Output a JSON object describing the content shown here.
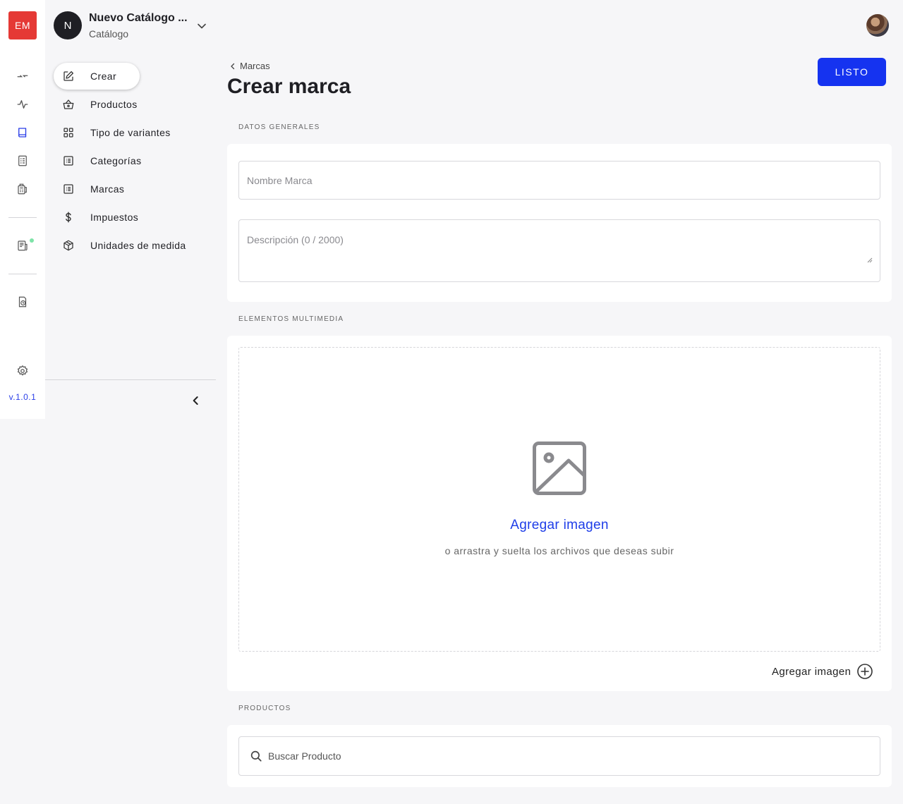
{
  "rail": {
    "logo": "EM",
    "version": "v.1.0.1",
    "icons": [
      "transfer-icon",
      "activity-icon",
      "book-icon",
      "checklist-icon",
      "pos-icon",
      "orders-icon",
      "reports-icon",
      "settings-icon"
    ]
  },
  "catalog": {
    "avatar_letter": "N",
    "title": "Nuevo Catálogo ...",
    "subtitle": "Catálogo"
  },
  "nav": {
    "items": [
      {
        "label": "Crear",
        "icon": "edit-icon"
      },
      {
        "label": "Productos",
        "icon": "basket-icon"
      },
      {
        "label": "Tipo de variantes",
        "icon": "grid-icon"
      },
      {
        "label": "Categorías",
        "icon": "list-icon"
      },
      {
        "label": "Marcas",
        "icon": "list-icon"
      },
      {
        "label": "Impuestos",
        "icon": "dollar-icon"
      },
      {
        "label": "Unidades de medida",
        "icon": "box-icon"
      }
    ]
  },
  "header": {
    "breadcrumb": "Marcas",
    "title": "Crear marca",
    "done_label": "LISTO"
  },
  "general": {
    "section_label": "DATOS GENERALES",
    "name_placeholder": "Nombre Marca",
    "description_placeholder": "Descripción (0 / 2000)"
  },
  "media": {
    "section_label": "ELEMENTOS MULTIMEDIA",
    "add_image_link": "Agregar imagen",
    "drop_hint": "o arrastra y suelta los archivos que deseas subir",
    "add_image_button": "Agregar imagen"
  },
  "products": {
    "section_label": "PRODUCTOS",
    "search_placeholder": "Buscar Producto"
  },
  "colors": {
    "accent": "#1533f0",
    "logo": "#e53935",
    "active_icon": "#2a3ee8"
  }
}
